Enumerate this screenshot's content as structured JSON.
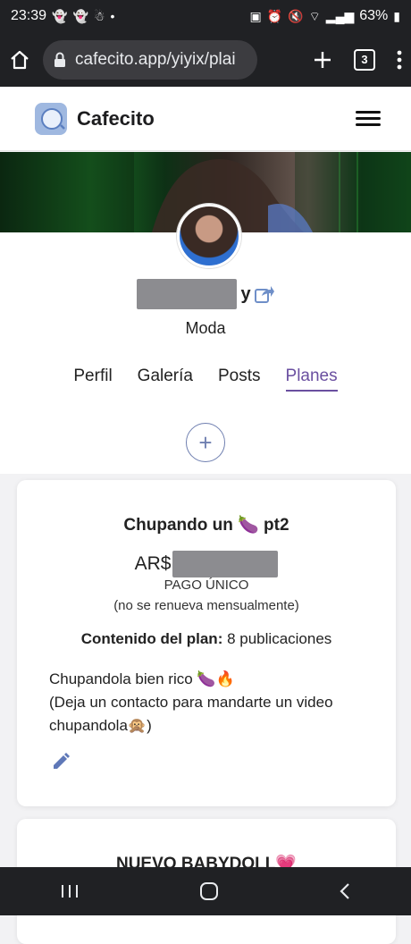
{
  "status_bar": {
    "time": "23:39",
    "battery": "63%"
  },
  "browser": {
    "url": "cafecito.app/yiyix/plai",
    "tab_count": "3"
  },
  "site": {
    "brand": "Cafecito"
  },
  "profile": {
    "name_suffix": "y",
    "category": "Moda"
  },
  "tabs": [
    {
      "label": "Perfil"
    },
    {
      "label": "Galería"
    },
    {
      "label": "Posts"
    },
    {
      "label": "Planes"
    }
  ],
  "active_tab": "Planes",
  "add_button_label": "+",
  "plans": [
    {
      "title": "Chupando un 🍆 pt2",
      "currency": "AR$",
      "payment_type": "PAGO ÚNICO",
      "renewal_note": "(no se renueva mensualmente)",
      "content_label": "Contenido del plan:",
      "content_value": "8 publicaciones",
      "description_line1": "Chupandola bien rico 🍆🔥",
      "description_line2": "(Deja un contacto para mandarte un video chupandola🙊)"
    },
    {
      "title": "NUEVO BABYDOLL💗"
    }
  ],
  "colors": {
    "accent": "#6a4fa0",
    "add_button": "#6f7fb0",
    "chrome_bg": "#202124"
  }
}
